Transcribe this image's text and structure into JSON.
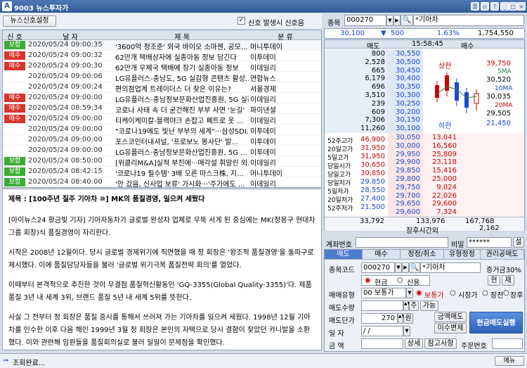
{
  "window": {
    "title": "9003 뉴스투자가",
    "controls": [
      "풀",
      "▫",
      "?",
      "_",
      "□",
      "×"
    ]
  },
  "toolbar": {
    "settings_button": "뉴스신호설정",
    "signal_check_label": "신호 발생시 신호음",
    "code_label": "종목",
    "code_value": "000270",
    "stock_name": "*기아차"
  },
  "news": {
    "headers": [
      "신 호",
      "날 자",
      "제 목",
      "분 류"
    ],
    "rows": [
      {
        "signal": "보합",
        "signal_color": "#3cab35",
        "date": "2020/05/24 09:00:35",
        "title": "'3600억 정조준' 외국 바이오 소마젠, 공모...",
        "cat": "머니투데이"
      },
      {
        "signal": "매수",
        "signal_color": "#d7352b",
        "date": "2020/05/24 09:00:32",
        "title": "62만개 택배상자에 실종아동 정보 담긴다",
        "cat": "이투데이"
      },
      {
        "signal": "매수",
        "signal_color": "#d7352b",
        "date": "2020/05/24 09:00:30",
        "title": "62만개 우체국 택배에 장기 실종아동 정보",
        "cat": "이데일리"
      },
      {
        "signal": "",
        "signal_color": "",
        "date": "2020/05/24 09:00:06",
        "title": "LG유플러스-충남도, 5G 실감형 콘텐츠 활성...",
        "cat": "연합뉴스"
      },
      {
        "signal": "",
        "signal_color": "",
        "date": "2020/05/24 09:00:24",
        "title": "편의점업계 트레이더스 더 찾은 이유는?",
        "cat": "서울경제"
      },
      {
        "signal": "매수",
        "signal_color": "#d7352b",
        "date": "2020/05/24 09:00:00",
        "title": "LG유플러스-충남정보문화산업진흥원, 5G 실감형...",
        "cat": "이데일리"
      },
      {
        "signal": "매수",
        "signal_color": "#d7352b",
        "date": "2020/05/24 08:59:34",
        "title": "코로나 사태 속 더 굳건해진 부부 사연 '눈길'",
        "cat": "파이낸셜"
      },
      {
        "signal": "매수",
        "signal_color": "#d7352b",
        "date": "2020/05/24 09:00:00",
        "title": "티케이케미칼-블랙야크 손잡고 페트로 옷 ...",
        "cat": "이데일리"
      },
      {
        "signal": "",
        "signal_color": "",
        "date": "2020/05/24 09:00:00",
        "title": "\"코로나19에도 빛난 부부의 세계\"···삼성SDI...",
        "cat": "이투데이"
      },
      {
        "signal": "",
        "signal_color": "",
        "date": "2020/05/24 09:00:00",
        "title": "포스코인터내셔널, '프로보노 봉사단' 발...",
        "cat": "이투데이"
      },
      {
        "signal": "",
        "signal_color": "",
        "date": "2020/05/24 09:00:00",
        "title": "LG유플러스·충남정보문화산업진흥원, 5G ...",
        "cat": "이투데이"
      },
      {
        "signal": "보합",
        "signal_color": "#3cab35",
        "date": "2020/05/24 08:50:00",
        "title": "[위클리M&A]실적 부진에···매각설 휘말린 외...",
        "cat": "이데일리"
      },
      {
        "signal": "보합",
        "signal_color": "#3cab35",
        "date": "2020/05/24 08:42:15",
        "title": "'코로나19 필수템' 3배 오른 마스크株, 지...",
        "cat": "머니투데이"
      },
      {
        "signal": "보합",
        "signal_color": "#3cab35",
        "date": "2020/05/24 08:40:00",
        "title": "'안 갔음, 신사업 보류' 가시화···'주가에도 ...",
        "cat": "이데일리"
      }
    ]
  },
  "article": {
    "title": "제목 : [100주년 질주 기아차 ⑩] MK의 품질경영, 일으켜 세웠다",
    "paragraphs": [
      "[아이뉴스24 황금빛 기자] 기아자동차가 글로벌 완성차 업체로 우뚝 서게 된 중심에는 MK(정몽구 현대차그룹 회장)식 품질경영이 자리한다.",
      "시작은 2008년 12월이다. 당시 글로벌 경제위기에 직면했을 때 정 회장은 '왕조적 품질경영'을 돌파구로 제시했다. 이에 품질담당자들을 불러 '글로벌 위기극복 품질전략 회의'를 열었다.",
      "이때부터 본격적으로 추진한 것이 무결점 품질혁신활동인 'GQ-3355(Global Quality-3355)'다. 제품 품질 3년 내 세계 3위, 브랜드 품질 5년 내 세계 5위를 뜻한다.",
      "사실 그 전부터 정 회장은 품질 중시를 통해서 쓰러져 가는 기아차를 일으켜 세웠다. 1998년 12월 기아차를 인수한 이후 다음 해인 1999년 3월 정 회장은 본인의 자택으로 당시 결함이 잦았던 카니발을 소환했다. 이와 관련해 임원들을 품질회의실로 불러 일일이 문제점을 확인했다."
    ]
  },
  "price": {
    "current": "30,100",
    "change": "500",
    "rate": "1.63%",
    "volume": "1,754,550"
  },
  "quote": {
    "head_ask": "매도",
    "time": "15:58:45",
    "head_bid": "매수",
    "asks": [
      {
        "qty": "800",
        "price": "30,550"
      },
      {
        "qty": "2,528",
        "price": "30,500"
      },
      {
        "qty": "665",
        "price": "30,450"
      },
      {
        "qty": "6,179",
        "price": "30,400"
      },
      {
        "qty": "696",
        "price": "30,350"
      },
      {
        "qty": "3,510",
        "price": "30,300"
      },
      {
        "qty": "239",
        "price": "30,250"
      },
      {
        "qty": "609",
        "price": "30,200"
      },
      {
        "qty": "7,306",
        "price": "30,150"
      },
      {
        "qty": "11,260",
        "price": "30,100"
      }
    ],
    "bids": [
      {
        "price": "30,050",
        "qty": "13,041"
      },
      {
        "price": "30,000",
        "qty": "16,560"
      },
      {
        "price": "29,950",
        "qty": "25,809"
      },
      {
        "price": "29,900",
        "qty": "23,118"
      },
      {
        "price": "29,850",
        "qty": "15,416"
      },
      {
        "price": "29,800",
        "qty": "25,000"
      },
      {
        "price": "29,750",
        "qty": "9,024"
      },
      {
        "price": "29,700",
        "qty": "22,026"
      },
      {
        "price": "29,650",
        "qty": "29,600"
      },
      {
        "price": "29,600",
        "qty": "7,324"
      }
    ],
    "stats": [
      {
        "k": "52주고가",
        "v": "46,900"
      },
      {
        "k": "20일고가",
        "v": "31,950"
      },
      {
        "k": "5일고가",
        "v": "31,950"
      },
      {
        "k": "당일시가",
        "v": "30,650"
      },
      {
        "k": "당일고가",
        "v": "30,850"
      },
      {
        "k": "당일저가",
        "v": "29,850"
      },
      {
        "k": "5일저가",
        "v": "28,550"
      },
      {
        "k": "20일저가",
        "v": "27,400"
      },
      {
        "k": "52주저가",
        "v": "21,500"
      }
    ],
    "mini": {
      "upper_label": "상한",
      "upper": "39,750",
      "lower_label": "하한",
      "lower": "21,450",
      "ma5": "5MA",
      "ma5_val": "30,520",
      "ma10": "10MA",
      "ma10_val": "30,035",
      "ma20": "20MA",
      "ma20_val": "29,505"
    },
    "total_ask": "33,792",
    "total_bid": "133,976",
    "diff": "167,768",
    "after_label": "장후시간외",
    "after_val": "2,162"
  },
  "account": {
    "label": "계좌번호",
    "pw_label": "비밀",
    "pw_value": "******",
    "setting": "설"
  },
  "order": {
    "tabs": [
      "매도",
      "매수",
      "정정/취소",
      "유형정정",
      "권리공매도"
    ],
    "code_label": "종목코드",
    "code": "000270",
    "name": "*기아차",
    "margin": "증거금30%",
    "cash": "현금",
    "credit": "신용",
    "now_btn": "현",
    "sub_btn": "재",
    "type_label": "매매유형",
    "type_value": "00 보통가",
    "opt1": "보통가",
    "opt2": "시장가",
    "opt3": "장전",
    "opt4": "장후",
    "qty_label": "매도수량",
    "qty_value": "",
    "all_btn": "주",
    "avail_btn": "가능",
    "price_label": "매도단가",
    "price_value": "270",
    "won": "원",
    "check_btn": "금액매도",
    "unfill_btn": "미수변제",
    "exec_btn": "현금매도실행",
    "date_label": "일 자",
    "date_value": "/   /",
    "amt_label": "금 액",
    "detail_btn": "상세",
    "ref_btn": "참고사항",
    "order_no_label": "주문번호"
  },
  "status": {
    "text": "조회완료...",
    "menu": "메뉴"
  }
}
